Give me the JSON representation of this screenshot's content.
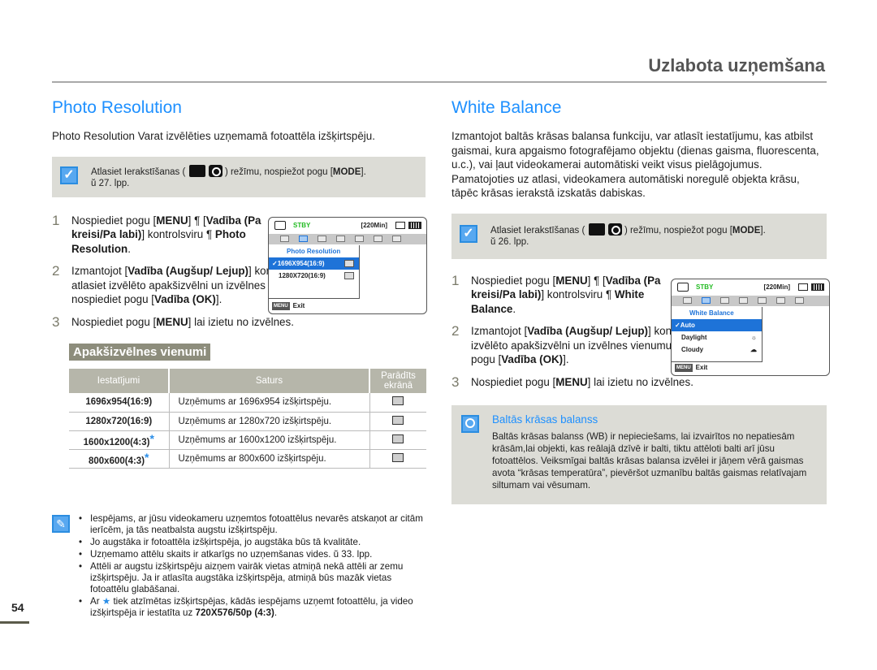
{
  "header": {
    "title": "Uzlabota uzņemšana"
  },
  "page_number": "54",
  "left": {
    "title": "Photo Resolution",
    "intro": "Photo Resolution Varat izvēlēties uzņemamā fotoattēla izšķirtspēju.",
    "note": {
      "text_before": "Atlasiet Ierakstīšanas (",
      "text_after": ") režīmu, nospiežot pogu [",
      "mode": "MODE",
      "close": "].",
      "page_ref": "ŭ 27. lpp."
    },
    "steps": [
      {
        "num": "1",
        "parts": [
          "Nospiediet pogu [",
          "MENU",
          "] ¶ [",
          "Vadība (Pa kreisi/Pa labi)",
          "] kontrolsviru ¶ ",
          "Photo Resolution",
          "."
        ]
      },
      {
        "num": "2",
        "parts": [
          "Izmantojot [",
          "Vadība (Augšup/ Lejup)",
          "] kontrolsviru, atlasiet izvēlēto apakšizvēlni un izvēlnes vienumu un tad nospiediet pogu [",
          "Vadība (OK)",
          "]."
        ]
      },
      {
        "num": "3",
        "parts": [
          "Nospiediet pogu [",
          "MENU",
          "] lai izietu no izvēlnes."
        ]
      }
    ],
    "lcd": {
      "status": "STBY",
      "remaining": "[220Min]",
      "menu_title": "Photo Resolution",
      "items": [
        "1696X954(16:9)",
        "1280X720(16:9)"
      ],
      "selected_index": 0,
      "menu_key": "MENU",
      "exit": "Exit"
    },
    "submenu_heading": "Apakšizvēlnes vienumi",
    "table": {
      "headers": [
        "Iestatījumi",
        "Saturs",
        "Parādīts ekrānā"
      ],
      "rows": [
        {
          "setting": "1696x954(16:9)",
          "star": false,
          "desc": "Uzņēmums ar 1696x954 izšķirtspēju.",
          "icon": "res-1696-icon"
        },
        {
          "setting": "1280x720(16:9)",
          "star": false,
          "desc": "Uzņēmums ar 1280x720 izšķirtspēju.",
          "icon": "res-1280-icon"
        },
        {
          "setting": "1600x1200(4:3)",
          "star": true,
          "desc": "Uzņēmums ar 1600x1200 izšķirtspēju.",
          "icon": "res-1600-icon"
        },
        {
          "setting": "800x600(4:3)",
          "star": true,
          "desc": "Uzņēmums ar 800x600 izšķirtspēju.",
          "icon": "res-800-icon"
        }
      ],
      "star_symbol": "*"
    },
    "notes": [
      "Iespējams, ar jūsu videokameru uzņemtos fotoattēlus nevarēs atskaņot ar citām ierīcēm, ja tās neatbalsta augstu izšķirtspēju.",
      "Jo augstāka ir fotoattēla izšķirtspēja, jo augstāka būs tā kvalitāte.",
      "Uzņemamo attēlu skaits ir atkarīgs no uzņemšanas vides. ŭ 33. lpp.",
      "Attēli ar augstu izšķirtspēju aizņem vairāk vietas atmiņā nekā attēli ar zemu izšķirtspēju. Ja ir atlasīta augstāka izšķirtspēja, atmiņā būs mazāk vietas fotoattēlu glabāšanai."
    ],
    "last_note": {
      "before": "Ar ",
      "star": "★",
      "middle": " tiek atzīmētas izšķirtspējas, kādās iespējams uzņemt fotoattēlu, ja video izšķirtspēja ir iestatīta uz ",
      "bold": "720X576/50p (4:3)",
      "end": "."
    }
  },
  "right": {
    "title": "White Balance",
    "intro": "Izmantojot baltās krāsas balansa funkciju, var atlasīt iestatījumu, kas atbilst gaismai, kura apgaismo fotografējamo objektu (dienas gaisma, fluorescenta, u.c.), vai ļaut videokamerai automātiski veikt visus pielāgojumus. Pamatojoties uz atlasi, videokamera automātiski noregulē objekta krāsu, tāpēc krāsas ierakstā izskatās dabiskas.",
    "note": {
      "text_before": "Atlasiet Ierakstīšanas (",
      "text_after": ") režīmu, nospiežot pogu [",
      "mode": "MODE",
      "close": "].",
      "page_ref": "ŭ 26. lpp."
    },
    "steps": [
      {
        "num": "1",
        "parts": [
          "Nospiediet pogu [",
          "MENU",
          "] ¶ [",
          "Vadība (Pa kreisi/Pa labi)",
          "] kontrolsviru ¶ ",
          "White Balance",
          "."
        ]
      },
      {
        "num": "2",
        "parts": [
          "Izmantojot [",
          "Vadība (Augšup/ Lejup)",
          "] kontrolsviru, atlasiet izvēlēto apakšizvēlni un izvēlnes vienumu un tad nospiediet pogu [",
          "Vadība (OK)",
          "]."
        ]
      },
      {
        "num": "3",
        "parts": [
          "Nospiediet pogu [",
          "MENU",
          "] lai izietu no izvēlnes."
        ]
      }
    ],
    "lcd": {
      "status": "STBY",
      "remaining": "[220Min]",
      "menu_title": "White Balance",
      "items": [
        "Auto",
        "Daylight",
        "Cloudy"
      ],
      "selected_index": 0,
      "menu_key": "MENU",
      "exit": "Exit"
    },
    "tip": {
      "title": "Baltās krāsas balanss",
      "body": "Baltās krāsas balanss (WB) ir nepieciešams, lai izvairītos no nepatiesām krāsām,lai objekti, kas reālajā dzīvē ir balti, tiktu attēloti balti arī jūsu fotoattēlos. Veiksmīgai baltās krāsas balansa izvēlei ir jāņem vērā gaismas avota “krāsas temperatūra”, pievēršot uzmanību baltās gaismas relatīvajam siltumam vai vēsumam."
    }
  },
  "colors": {
    "accent": "#1e90ff",
    "note_bg": "#dcdcd6",
    "subhead_bg": "#8d8d7c",
    "table_header_bg": "#b6b6aa",
    "lcd_select": "#1e73d8",
    "stby": "#22bb22"
  }
}
